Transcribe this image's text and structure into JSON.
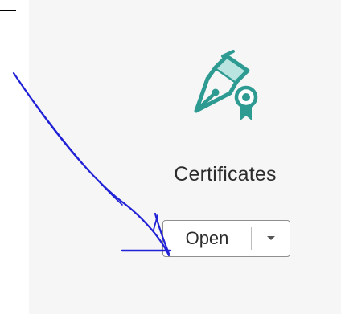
{
  "tool_card": {
    "title": "Certificates",
    "icon": "certificate-pen-icon",
    "open_label": "Open",
    "dropdown_icon": "chevron-down-icon"
  },
  "colors": {
    "icon_teal": "#2e9b92",
    "icon_light": "#b9e4df",
    "annotation_blue": "#2121d6",
    "panel_bg": "#f6f6f6"
  }
}
